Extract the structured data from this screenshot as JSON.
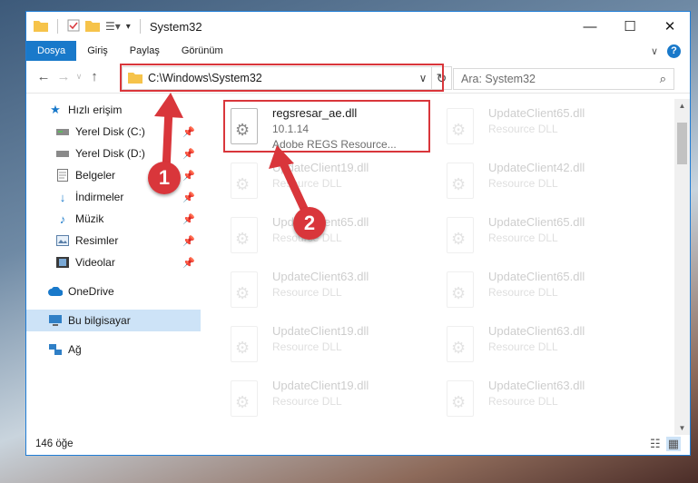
{
  "window": {
    "title": "System32"
  },
  "ribbon": {
    "tabs": [
      "Dosya",
      "Giriş",
      "Paylaş",
      "Görünüm"
    ]
  },
  "address": {
    "path": "C:\\Windows\\System32"
  },
  "search": {
    "placeholder": "Ara: System32"
  },
  "sidebar": {
    "items": [
      {
        "label": "Hızlı erişim",
        "icon": "star-icon"
      },
      {
        "label": "Yerel Disk (C:)",
        "icon": "drive-icon"
      },
      {
        "label": "Yerel Disk (D:)",
        "icon": "drive-icon"
      },
      {
        "label": "Belgeler",
        "icon": "documents-icon"
      },
      {
        "label": "İndirmeler",
        "icon": "download-icon"
      },
      {
        "label": "Müzik",
        "icon": "music-icon"
      },
      {
        "label": "Resimler",
        "icon": "pictures-icon"
      },
      {
        "label": "Videolar",
        "icon": "video-icon"
      },
      {
        "label": "OneDrive",
        "icon": "cloud-icon"
      },
      {
        "label": "Bu bilgisayar",
        "icon": "computer-icon"
      },
      {
        "label": "Ağ",
        "icon": "network-icon"
      }
    ]
  },
  "files": [
    {
      "name": "regsresar_ae.dll",
      "version": "10.1.14",
      "desc": "Adobe REGS Resource..."
    },
    {
      "name": "UpdateClient65.dll",
      "desc": "Resource DLL"
    },
    {
      "name": "UpdateClient19.dll",
      "desc": "Resource DLL"
    },
    {
      "name": "UpdateClient42.dll",
      "desc": "Resource DLL"
    },
    {
      "name": "UpdateClient65.dll",
      "desc": "Resource DLL"
    },
    {
      "name": "UpdateClient65.dll",
      "desc": "Resource DLL"
    },
    {
      "name": "UpdateClient63.dll",
      "desc": "Resource DLL"
    },
    {
      "name": "UpdateClient65.dll",
      "desc": "Resource DLL"
    },
    {
      "name": "UpdateClient19.dll",
      "desc": "Resource DLL"
    },
    {
      "name": "UpdateClient63.dll",
      "desc": "Resource DLL"
    },
    {
      "name": "UpdateClient19.dll",
      "desc": "Resource DLL"
    },
    {
      "name": "UpdateClient63.dll",
      "desc": "Resource DLL"
    }
  ],
  "status": {
    "count": "146 öğe"
  },
  "annotations": {
    "step1": "1",
    "step2": "2"
  },
  "colors": {
    "accent": "#1979ca",
    "highlight": "#d9363b",
    "selected": "#cde3f7"
  }
}
